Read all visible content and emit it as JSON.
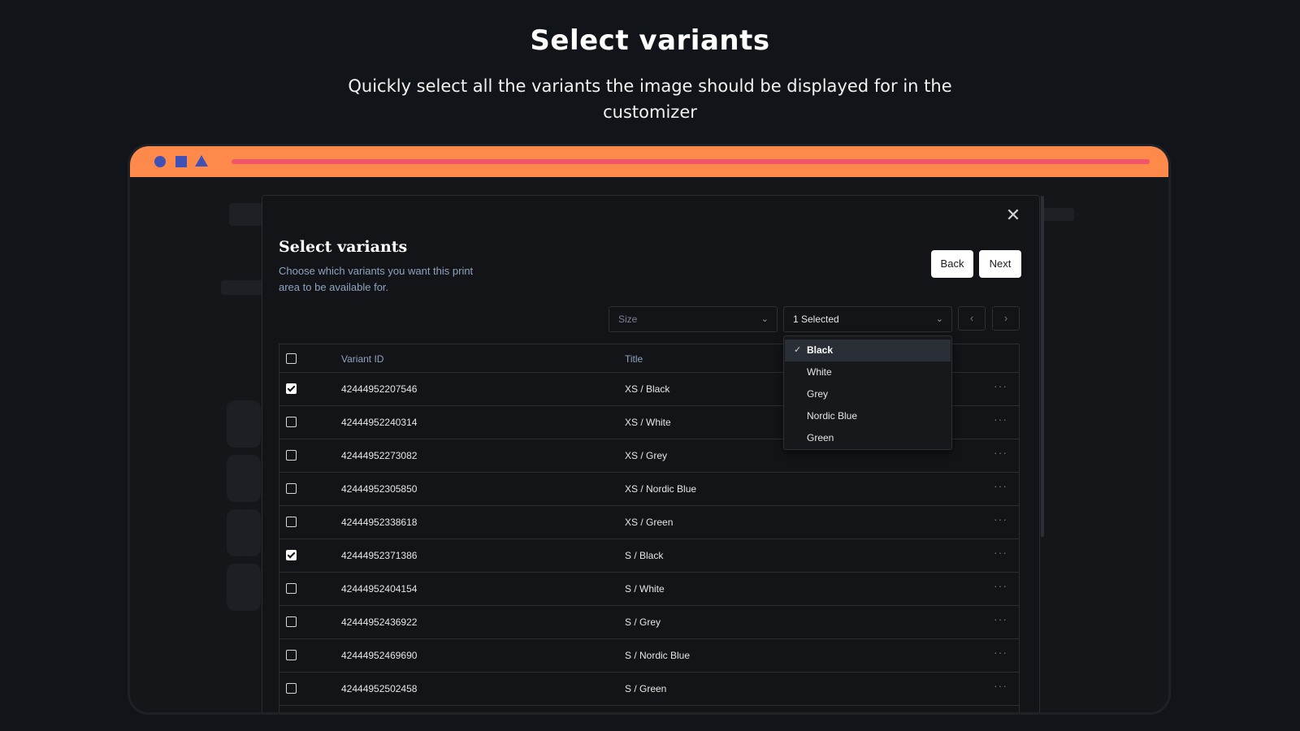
{
  "hero": {
    "title": "Select variants",
    "subtitle": "Quickly select all the variants the image should be displayed for in the customizer"
  },
  "colors": {
    "background": "#111418",
    "frame_bar": "#fd8a4b",
    "bar_line": "#f0556c",
    "frame_shapes": "#3f51b5",
    "modal_bg": "#121417",
    "muted_text": "#8fa3c0"
  },
  "modal": {
    "title": "Select variants",
    "description": "Choose which variants you want this print area to be available for.",
    "back_label": "Back",
    "next_label": "Next",
    "close_icon": "close-icon"
  },
  "filters": {
    "size_placeholder": "Size",
    "color_value": "1 Selected",
    "prev_icon": "chevron-left-icon",
    "next_icon": "chevron-right-icon"
  },
  "color_dropdown": {
    "options": [
      {
        "label": "Black",
        "selected": true
      },
      {
        "label": "White",
        "selected": false
      },
      {
        "label": "Grey",
        "selected": false
      },
      {
        "label": "Nordic Blue",
        "selected": false
      },
      {
        "label": "Green",
        "selected": false
      }
    ]
  },
  "table": {
    "columns": [
      "Variant ID",
      "Title"
    ],
    "rows": [
      {
        "id": "42444952207546",
        "title": "XS / Black",
        "checked": true
      },
      {
        "id": "42444952240314",
        "title": "XS / White",
        "checked": false
      },
      {
        "id": "42444952273082",
        "title": "XS / Grey",
        "checked": false
      },
      {
        "id": "42444952305850",
        "title": "XS / Nordic Blue",
        "checked": false
      },
      {
        "id": "42444952338618",
        "title": "XS / Green",
        "checked": false
      },
      {
        "id": "42444952371386",
        "title": "S / Black",
        "checked": true
      },
      {
        "id": "42444952404154",
        "title": "S / White",
        "checked": false
      },
      {
        "id": "42444952436922",
        "title": "S / Grey",
        "checked": false
      },
      {
        "id": "42444952469690",
        "title": "S / Nordic Blue",
        "checked": false
      },
      {
        "id": "42444952502458",
        "title": "S / Green",
        "checked": false
      }
    ],
    "more_symbol": "···"
  }
}
